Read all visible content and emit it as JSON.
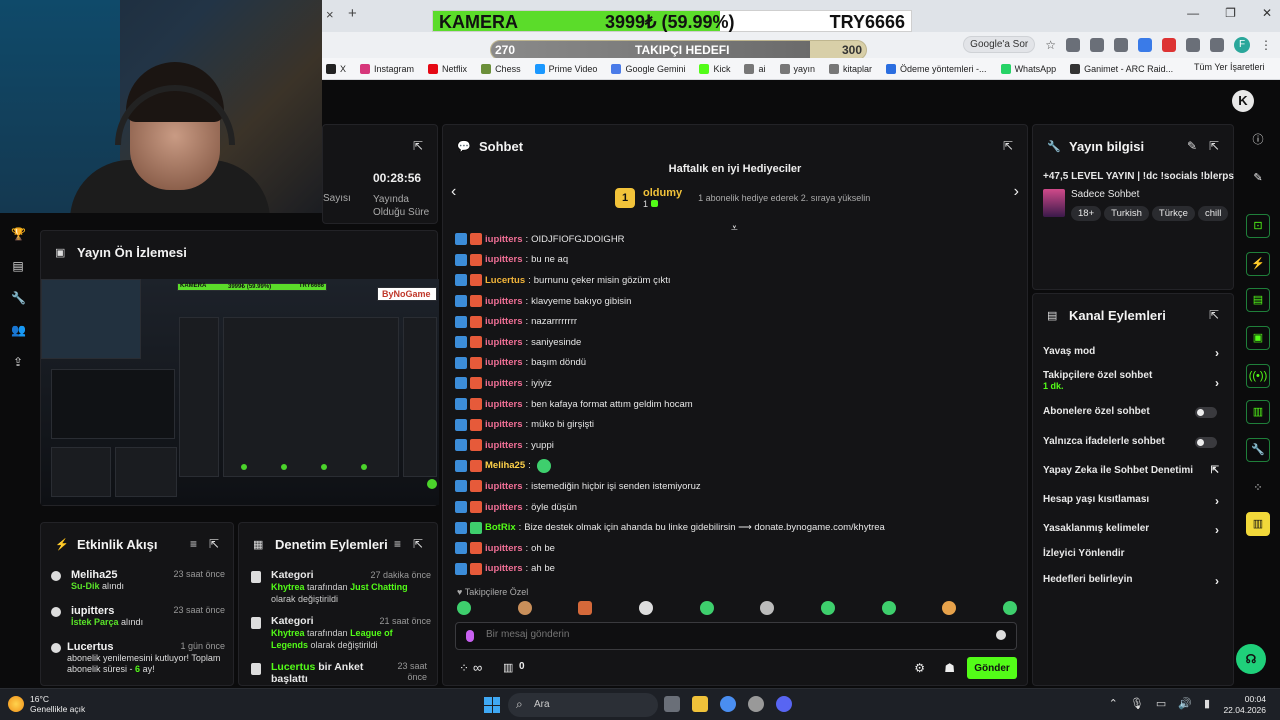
{
  "overlay": {
    "camera_label": "KAMERA",
    "camera_amount": "3999₺ (59.99%)",
    "camera_progress": 0.5999,
    "camera_target": "TRY6666",
    "goal_start": "270",
    "goal_label": "TAKIPÇI HEDEFI",
    "goal_end": "300",
    "goal_progress": 0.85
  },
  "browser": {
    "google_pill": "Google'a Sor",
    "profile_initial": "F",
    "bookmarks": [
      "X",
      "Instagram",
      "Netflix",
      "Chess",
      "Prime Video",
      "Google Gemini",
      "Kick",
      "ai",
      "yayın",
      "kitaplar",
      "Ödeme yöntemleri -...",
      "WhatsApp",
      "Ganimet - ARC Raid..."
    ],
    "bookmark_colors": [
      "#222222",
      "#d6367a",
      "#e50914",
      "#6b8f3a",
      "#1a98ff",
      "#4a7be8",
      "#53fc18",
      "#777777",
      "#777777",
      "#777777",
      "#2b6ee0",
      "#25d366",
      "#333333"
    ],
    "all_bookmarks": "Tüm Yer İşaretleri"
  },
  "stats": {
    "time": "00:28:56",
    "left_label": "Sayısı",
    "time_label": "Yayında Olduğu Süre"
  },
  "preview": {
    "title": "Yayın Ön İzlemesi",
    "mini_title": "KAMERA",
    "mini_amount": "3999₺ (59.99%)",
    "mini_target": "TRY6666",
    "mini_brand": "ByNoGame"
  },
  "activity": {
    "title": "Etkinlik Akışı",
    "items": [
      {
        "name": "Meliha25",
        "sub": "Su-Dik",
        "suffix": " alındı",
        "time": "23 saat önce"
      },
      {
        "name": "iupitters",
        "sub": "İstek Parça",
        "suffix": " alındı",
        "time": "23 saat önce"
      },
      {
        "name": "Lucertus",
        "text": "abonelik yenilemesini kutluyor! Toplam abonelik süresi - ",
        "months": "6",
        "after": " ay!",
        "time": "1 gün önce"
      }
    ]
  },
  "moderation": {
    "title": "Denetim Eylemleri",
    "items": [
      {
        "head": "Kategori",
        "user": "Khytrea",
        "mid": " tarafından ",
        "target": "Just Chatting",
        "tail": " olarak değiştirildi",
        "time": "27 dakika önce"
      },
      {
        "head": "Kategori",
        "user": "Khytrea",
        "mid": " tarafından ",
        "target": "League of Legends",
        "tail": " olarak değiştirildi",
        "time": "21 saat önce"
      },
      {
        "user": "Lucertus",
        "head": " bir Anket başlattı",
        "time": "23 saat önce"
      }
    ]
  },
  "chat": {
    "title": "Sohbet",
    "top_gifters_title": "Haftalık en iyi Hediyeciler",
    "top_rank": "1",
    "top_gifter": "oldumy",
    "top_gifter_count": "1",
    "top_gifter_hint": "1 abonelik hediye ederek 2. sıraya yükselin",
    "messages": [
      {
        "user": "iupitters",
        "color": "#ef6f95",
        "text": "OIDJFIOFGJDOIGHR"
      },
      {
        "user": "iupitters",
        "color": "#ef6f95",
        "text": "bu ne aq"
      },
      {
        "user": "Lucertus",
        "color": "#f2b53a",
        "text": "burnunu çeker misin gözüm çıktı"
      },
      {
        "user": "iupitters",
        "color": "#ef6f95",
        "text": "klavyeme bakıyo gibisin"
      },
      {
        "user": "iupitters",
        "color": "#ef6f95",
        "text": "nazarrrrrrrr"
      },
      {
        "user": "iupitters",
        "color": "#ef6f95",
        "text": "saniyesinde"
      },
      {
        "user": "iupitters",
        "color": "#ef6f95",
        "text": "başım döndü"
      },
      {
        "user": "iupitters",
        "color": "#ef6f95",
        "text": "iyiyiz"
      },
      {
        "user": "iupitters",
        "color": "#ef6f95",
        "text": "ben kafaya format attım geldim hocam"
      },
      {
        "user": "iupitters",
        "color": "#ef6f95",
        "text": "müko bi girşişti"
      },
      {
        "user": "iupitters",
        "color": "#ef6f95",
        "text": "yuppi"
      },
      {
        "user": "Meliha25",
        "color": "#ffd24a",
        "text": ""
      },
      {
        "user": "iupitters",
        "color": "#ef6f95",
        "text": "istemediğin hiçbir işi senden istemiyoruz"
      },
      {
        "user": "iupitters",
        "color": "#ef6f95",
        "text": "öyle düşün"
      },
      {
        "user": "BotRix",
        "color": "#53fc18",
        "text": "Bize destek olmak için ahanda bu linke gidebilirsin ⟶ donate.bynogame.com/khytrea"
      },
      {
        "user": "iupitters",
        "color": "#ef6f95",
        "text": "oh be"
      },
      {
        "user": "iupitters",
        "color": "#ef6f95",
        "text": "ah be"
      }
    ],
    "emotes_label": "Takipçilere Özel",
    "input_placeholder": "Bir mesaj gönderin",
    "points": "∞",
    "count": "0",
    "send_label": "Gönder"
  },
  "info": {
    "title": "Yayın bilgisi",
    "stream_title": "+47,5 LEVEL YAYIN | !dc !socials !blerps",
    "category": "Sadece Sohbet",
    "tags": [
      "18+",
      "Turkish",
      "Türkçe",
      "chill"
    ]
  },
  "channel_actions": {
    "title": "Kanal Eylemleri",
    "items": [
      {
        "label": "Yavaş mod",
        "control": "chevron"
      },
      {
        "label": "Takipçilere özel sohbet",
        "sub": "1 dk.",
        "control": "chevron"
      },
      {
        "label": "Abonelere özel sohbet",
        "control": "toggle"
      },
      {
        "label": "Yalnızca ifadelerle sohbet",
        "control": "toggle"
      },
      {
        "label": "Yapay Zeka ile Sohbet Denetimi",
        "control": "external"
      },
      {
        "label": "Hesap yaşı kısıtlaması",
        "control": "chevron"
      },
      {
        "label": "Yasaklanmış kelimeler",
        "control": "chevron"
      },
      {
        "label": "İzleyici Yönlendir",
        "control": "none"
      },
      {
        "label": "Hedefleri belirleyin",
        "control": "chevron"
      }
    ]
  },
  "taskbar": {
    "temperature": "16°C",
    "weather": "Genellikle açık",
    "search": "Ara",
    "time": "00:04",
    "date": "22.04.2026"
  }
}
